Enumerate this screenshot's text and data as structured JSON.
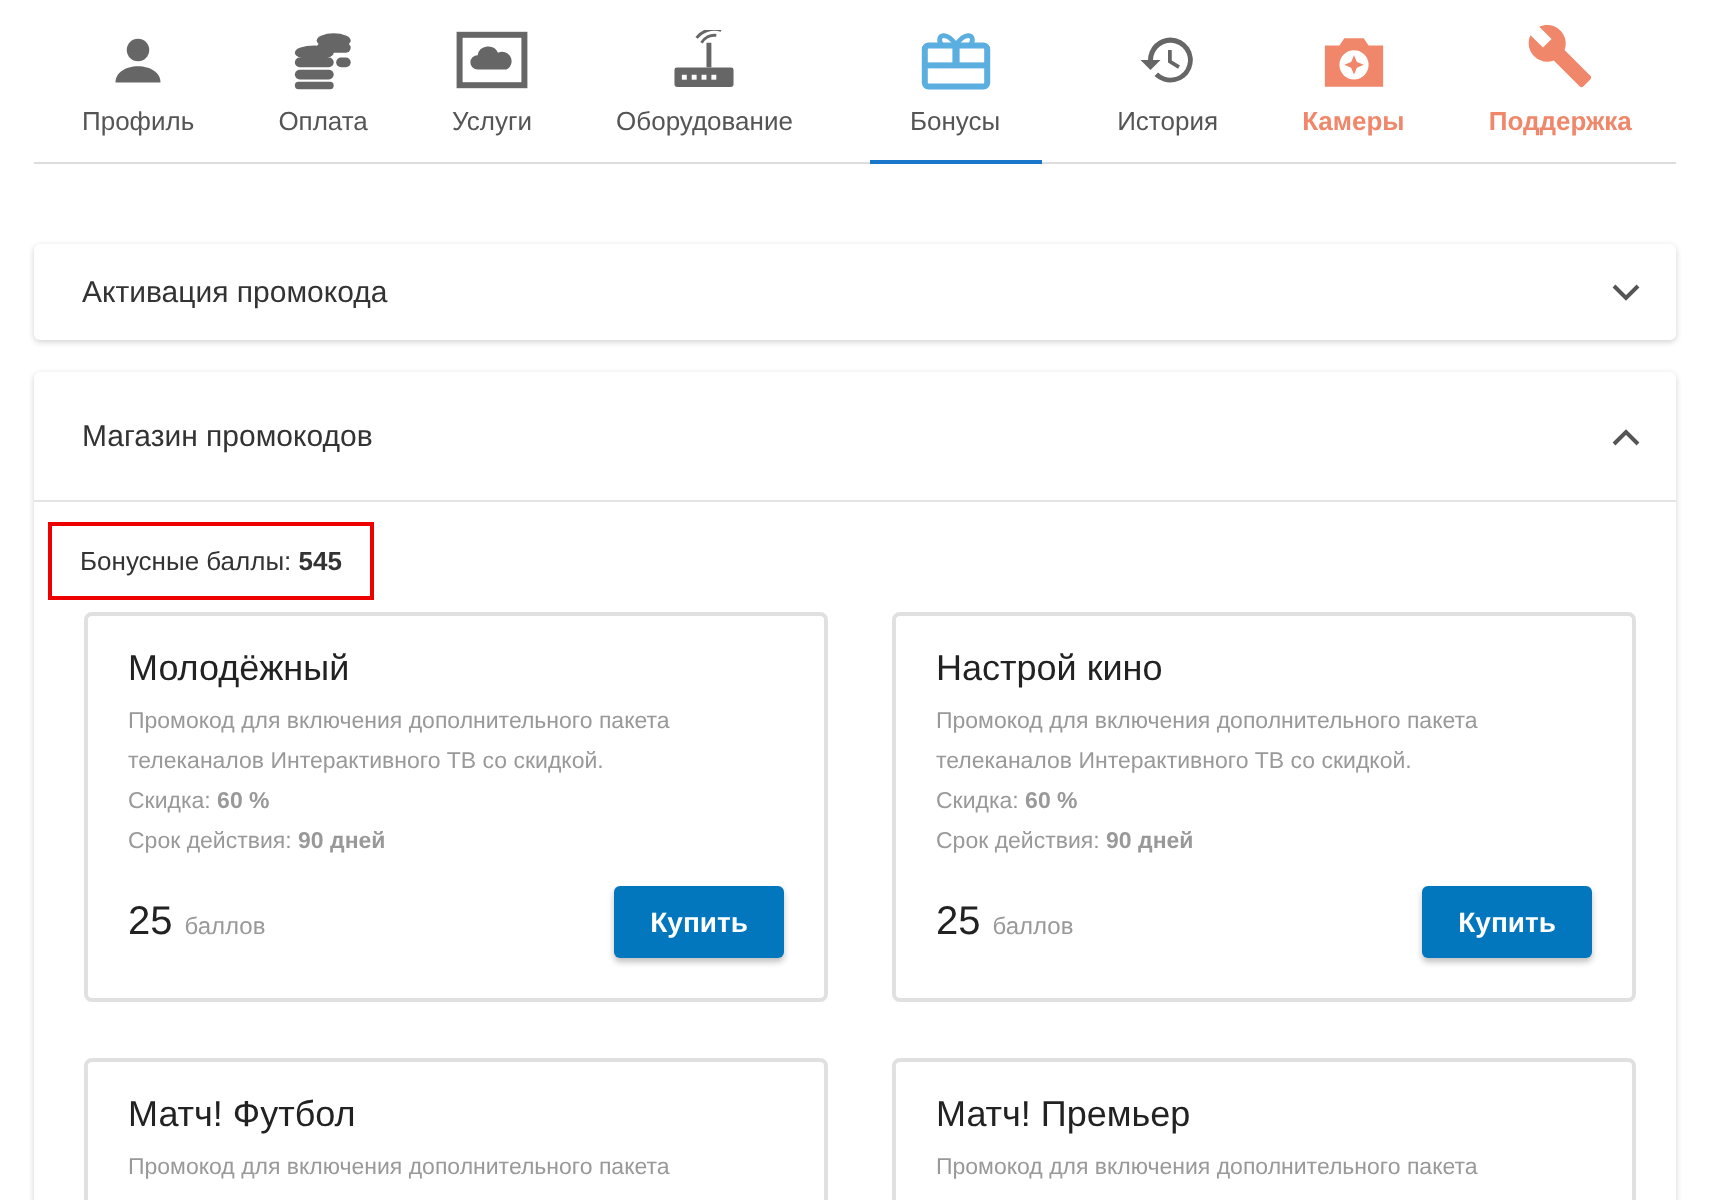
{
  "tabs": [
    {
      "label": "Профиль",
      "selected": false,
      "color": "#666666"
    },
    {
      "label": "Оплата",
      "selected": false,
      "color": "#666666"
    },
    {
      "label": "Услуги",
      "selected": false,
      "color": "#666666"
    },
    {
      "label": "Оборудование",
      "selected": false,
      "color": "#666666"
    },
    {
      "label": "Бонусы",
      "selected": true,
      "color": "#5aaee0"
    },
    {
      "label": "История",
      "selected": false,
      "color": "#666666"
    },
    {
      "label": "Камеры",
      "selected": false,
      "color": "#f0876a"
    },
    {
      "label": "Поддержка",
      "selected": false,
      "color": "#f0876a"
    }
  ],
  "sections": [
    {
      "title": "Активация промокода",
      "expanded": false
    },
    {
      "title": "Магазин промокодов",
      "expanded": true,
      "balance": {
        "text": "Бонусные баллы: **545**",
        "highlighted": true
      },
      "cards": [
        {
          "title": "Молодёжный",
          "description": "Промокод для включения дополнительного пакета телеканалов Интерактивного ТВ со скидкой.",
          "details": [
            "Скидка: **60 %**",
            "Срок действия: **90 дней**"
          ],
          "price": "25",
          "unit": "баллов",
          "button": "Купить"
        },
        {
          "title": "Настрой кино",
          "description": "Промокод для включения дополнительного пакета телеканалов Интерактивного ТВ со скидкой.",
          "details": [
            "Скидка: **60 %**",
            "Срок действия: **90 дней**"
          ],
          "price": "25",
          "unit": "баллов",
          "button": "Купить"
        },
        {
          "title": "Матч! Футбол",
          "description": "Промокод для включения дополнительного пакета"
        },
        {
          "title": "Матч! Премьер",
          "description": "Промокод для включения дополнительного пакета"
        }
      ]
    }
  ]
}
